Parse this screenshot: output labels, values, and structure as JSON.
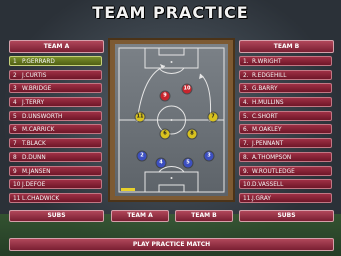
{
  "title": "TEAM PRACTICE",
  "team_a": {
    "header": "TEAM A",
    "players": [
      {
        "num": "1",
        "name": "P.GERRARD"
      },
      {
        "num": "2",
        "name": "J.CURTIS"
      },
      {
        "num": "3",
        "name": "W.BRIDGE"
      },
      {
        "num": "4",
        "name": "J.TERRY"
      },
      {
        "num": "5",
        "name": "D.UNSWORTH"
      },
      {
        "num": "6",
        "name": "M.CARRICK"
      },
      {
        "num": "7",
        "name": "T.BLACK"
      },
      {
        "num": "8",
        "name": "D.DUNN"
      },
      {
        "num": "9",
        "name": "M.JANSEN"
      },
      {
        "num": "10",
        "name": "J.DEFOE"
      },
      {
        "num": "11",
        "name": "L.CHADWICK"
      }
    ]
  },
  "team_b": {
    "header": "TEAM B",
    "players": [
      {
        "num": "1.",
        "name": "R.WRIGHT"
      },
      {
        "num": "2.",
        "name": "R.EDGEHILL"
      },
      {
        "num": "3.",
        "name": "G.BARRY"
      },
      {
        "num": "4.",
        "name": "H.MULLINS"
      },
      {
        "num": "5.",
        "name": "C.SHORT"
      },
      {
        "num": "6.",
        "name": "M.OAKLEY"
      },
      {
        "num": "7.",
        "name": "J.PENNANT"
      },
      {
        "num": "8.",
        "name": "A.THOMPSON"
      },
      {
        "num": "9.",
        "name": "W.ROUTLEDGE"
      },
      {
        "num": "10.",
        "name": "D.VASSELL"
      },
      {
        "num": "11.",
        "name": "J.GRAY"
      }
    ]
  },
  "buttons": {
    "subs_left": "SUBS",
    "team_a": "TEAM A",
    "team_b": "TEAM B",
    "subs_right": "SUBS",
    "play": "PLAY PRACTICE MATCH"
  },
  "pitch_markers": {
    "red": [
      "9",
      "10"
    ],
    "yellow_team": [
      "11",
      "6",
      "8",
      "7"
    ],
    "blue": [
      "2",
      "4",
      "5",
      "3"
    ]
  },
  "colors": {
    "red_marker": "#c8242c",
    "yellow_marker": "#d8c21e",
    "blue_marker": "#3c4fc0",
    "selected_row": "#7a8f2a"
  }
}
